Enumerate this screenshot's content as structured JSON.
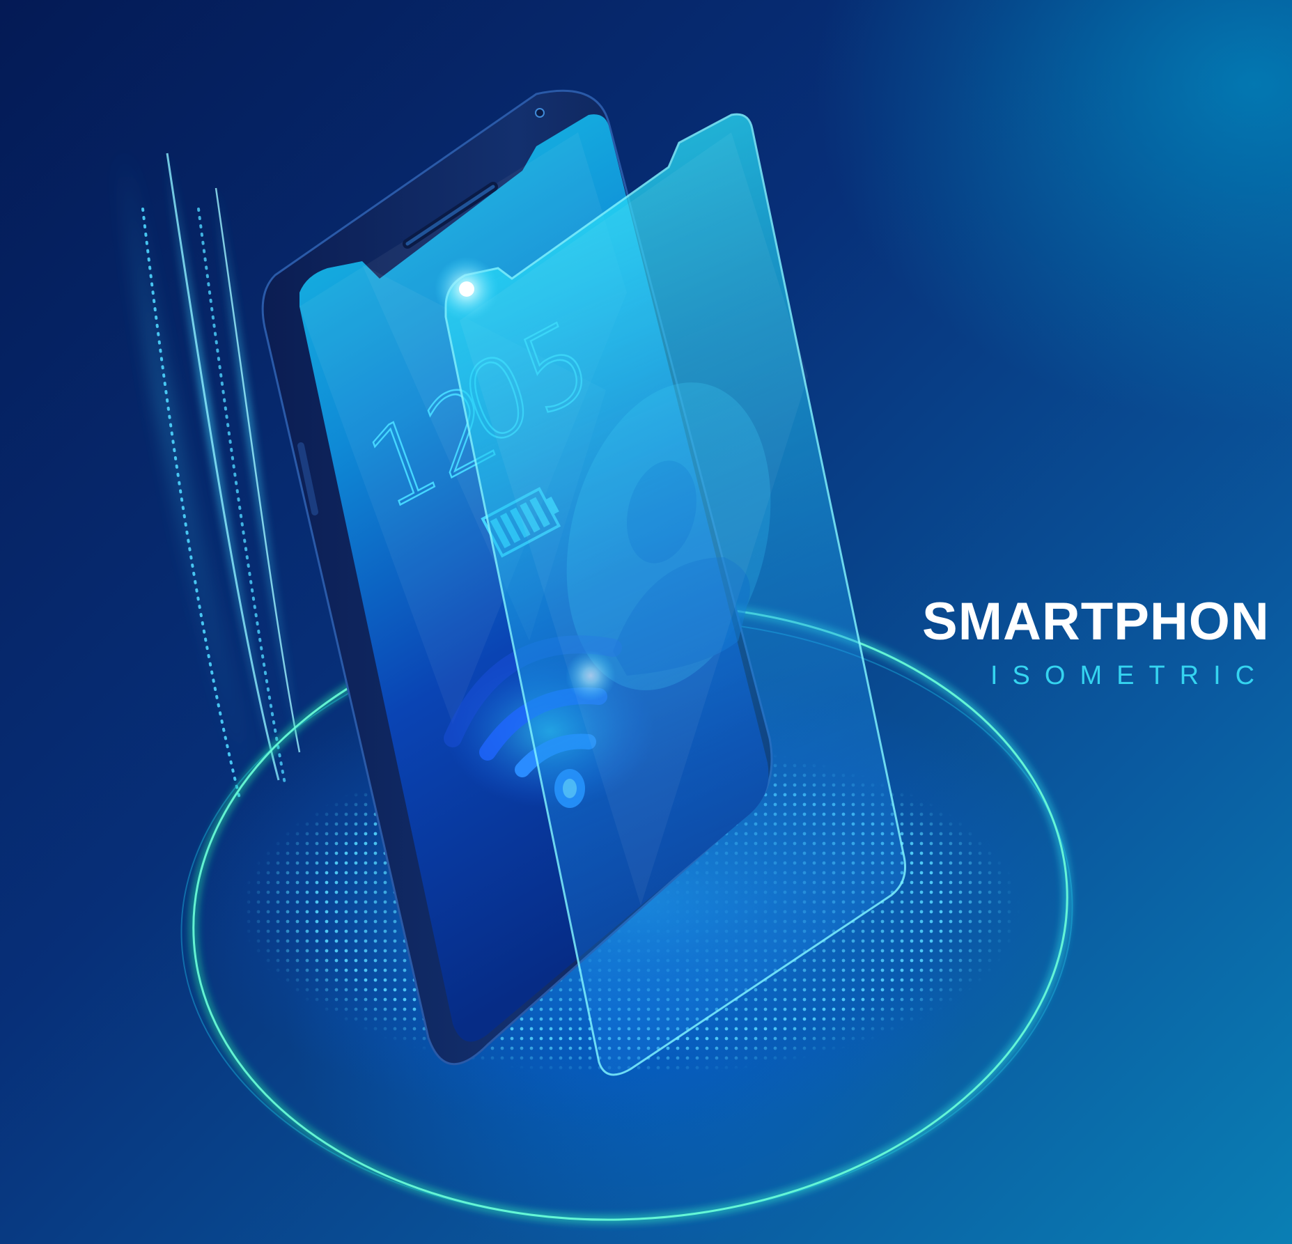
{
  "title": "SMARTPHON",
  "subtitle": "ISOMETRIC",
  "screen": {
    "clock_hours": "12",
    "clock_minutes": "05",
    "icons": [
      "battery-icon",
      "user-icon",
      "wifi-icon"
    ]
  },
  "colors": {
    "background_dark": "#041a55",
    "background_light": "#0a7fb4",
    "accent_cyan": "#35d4f0",
    "ring_green": "#2ee8a8",
    "title_white": "#ffffff"
  }
}
